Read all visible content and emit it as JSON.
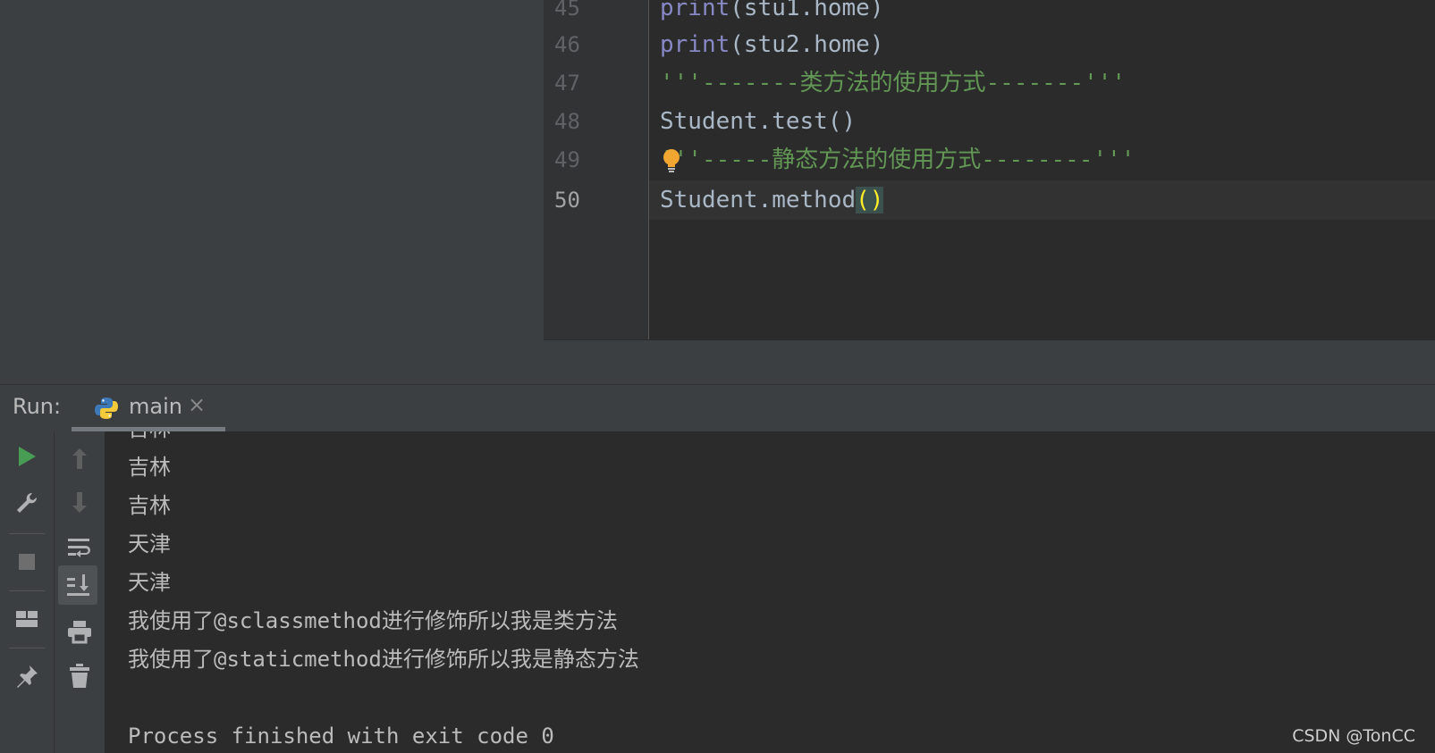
{
  "editor": {
    "lines": [
      {
        "num": "45",
        "kw": "print",
        "rest": "(stu1.home)"
      },
      {
        "num": "46",
        "kw": "print",
        "rest": "(stu2.home)"
      },
      {
        "num": "47",
        "text": "'''-------类方法的使用方式-------'''"
      },
      {
        "num": "48",
        "text": "Student.test()"
      },
      {
        "num": "49",
        "text": "'''-----静态方法的使用方式--------'''"
      },
      {
        "num": "50",
        "text": "Student.method",
        "paren": "()"
      }
    ]
  },
  "run": {
    "label": "Run:",
    "tab_label": "main",
    "close_glyph": "×"
  },
  "toolbar_icons": [
    "run-icon",
    "wrench-icon",
    "stop-icon",
    "layout-icon",
    "pin-icon",
    "arrow-up-icon",
    "arrow-down-icon",
    "soft-wrap-icon",
    "scroll-to-end-icon",
    "print-icon",
    "trash-icon"
  ],
  "console": {
    "lines": [
      "吉林",
      "吉林",
      "吉林",
      "天津",
      "天津",
      "我使用了@sclassmethod进行修饰所以我是类方法",
      "我使用了@staticmethod进行修饰所以我是静态方法",
      "",
      "Process finished with exit code 0"
    ]
  },
  "watermark": "CSDN @TonCC",
  "colors": {
    "editor_bg": "#2b2b2b",
    "panel_bg": "#3c3f41",
    "keyword_print": "#8888c6",
    "string": "#629755",
    "plain_text": "#a9b7c6",
    "run_green": "#499c54",
    "bulb": "#f0a732"
  }
}
